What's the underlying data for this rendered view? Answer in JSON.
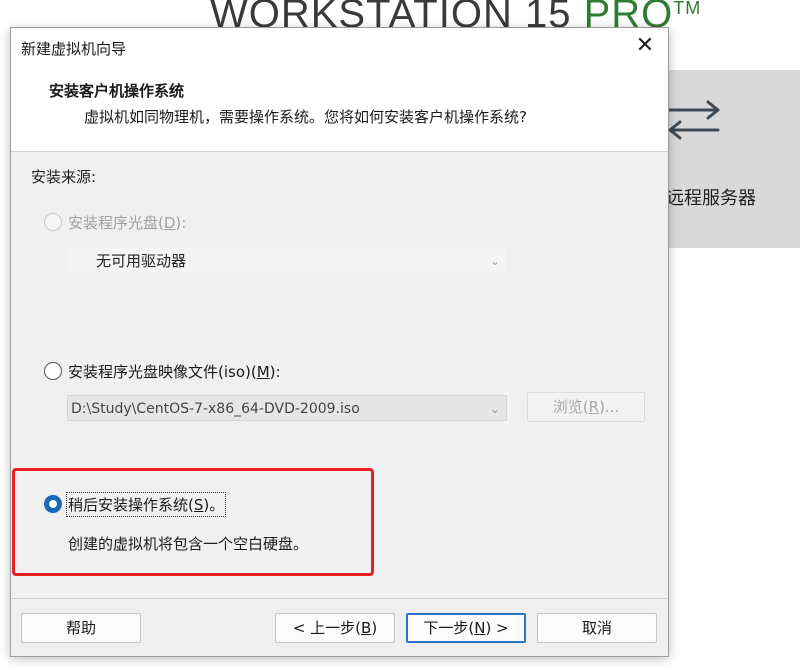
{
  "background": {
    "brand": "WORKSTATION 15",
    "brand_accent": "PRO",
    "trademark": "TM",
    "panel_label": "远程服务器",
    "panel_icon": "swap-arrows-icon"
  },
  "dialog": {
    "title": "新建虚拟机向导",
    "close_glyph": "✕",
    "header_title": "安装客户机操作系统",
    "header_subtitle": "虚拟机如同物理机，需要操作系统。您将如何安装客户机操作系统?",
    "source_label": "安装来源:",
    "option_disc": {
      "label_pre": "安装程序光盘(",
      "label_key": "D",
      "label_post": "):",
      "selected": false,
      "enabled": false,
      "drive_value": "无可用驱动器"
    },
    "option_iso": {
      "label_pre": "安装程序光盘映像文件(iso)(",
      "label_key": "M",
      "label_post": "):",
      "selected": false,
      "enabled": true,
      "path_value": "D:\\Study\\CentOS-7-x86_64-DVD-2009.iso",
      "browse_pre": "浏览(",
      "browse_key": "R",
      "browse_post": ")..."
    },
    "option_later": {
      "label_pre": "稍后安装操作系统(",
      "label_key": "S",
      "label_post": ")。",
      "selected": true,
      "description": "创建的虚拟机将包含一个空白硬盘。"
    },
    "buttons": {
      "help": "帮助",
      "back_pre": "< 上一步(",
      "back_key": "B",
      "back_post": ")",
      "next_pre": "下一步(",
      "next_key": "N",
      "next_post": ") >",
      "cancel": "取消"
    },
    "highlight_color": "#e62020",
    "accent_color": "#1a66b8"
  }
}
